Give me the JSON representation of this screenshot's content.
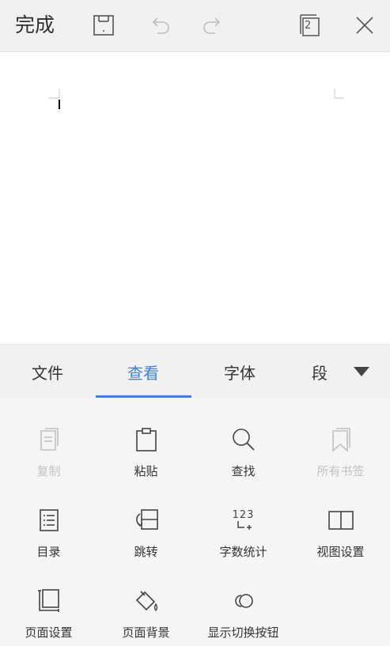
{
  "toolbar": {
    "done_label": "完成",
    "page_count": "2",
    "icons": [
      "save-icon",
      "undo-icon",
      "redo-icon",
      "page-count-icon",
      "close-icon"
    ]
  },
  "tabs": [
    {
      "label": "文件",
      "active": false
    },
    {
      "label": "查看",
      "active": true
    },
    {
      "label": "字体",
      "active": false
    },
    {
      "label": "段",
      "active": false
    }
  ],
  "accent_color": "#3b82d9",
  "panel": {
    "items": [
      {
        "label": "复制",
        "icon": "copy-icon",
        "enabled": false
      },
      {
        "label": "粘贴",
        "icon": "paste-icon",
        "enabled": true
      },
      {
        "label": "查找",
        "icon": "search-icon",
        "enabled": true
      },
      {
        "label": "所有书签",
        "icon": "bookmark-icon",
        "enabled": false
      },
      {
        "label": "目录",
        "icon": "toc-icon",
        "enabled": true
      },
      {
        "label": "跳转",
        "icon": "jump-icon",
        "enabled": true
      },
      {
        "label": "字数统计",
        "icon": "word-count-icon",
        "enabled": true,
        "icon_text": "123"
      },
      {
        "label": "视图设置",
        "icon": "book-icon",
        "enabled": true
      },
      {
        "label": "页面设置",
        "icon": "page-setup-icon",
        "enabled": true
      },
      {
        "label": "页面背景",
        "icon": "fill-icon",
        "enabled": true
      },
      {
        "label": "显示切换按钮",
        "icon": "toggle-icon",
        "enabled": true
      }
    ]
  }
}
